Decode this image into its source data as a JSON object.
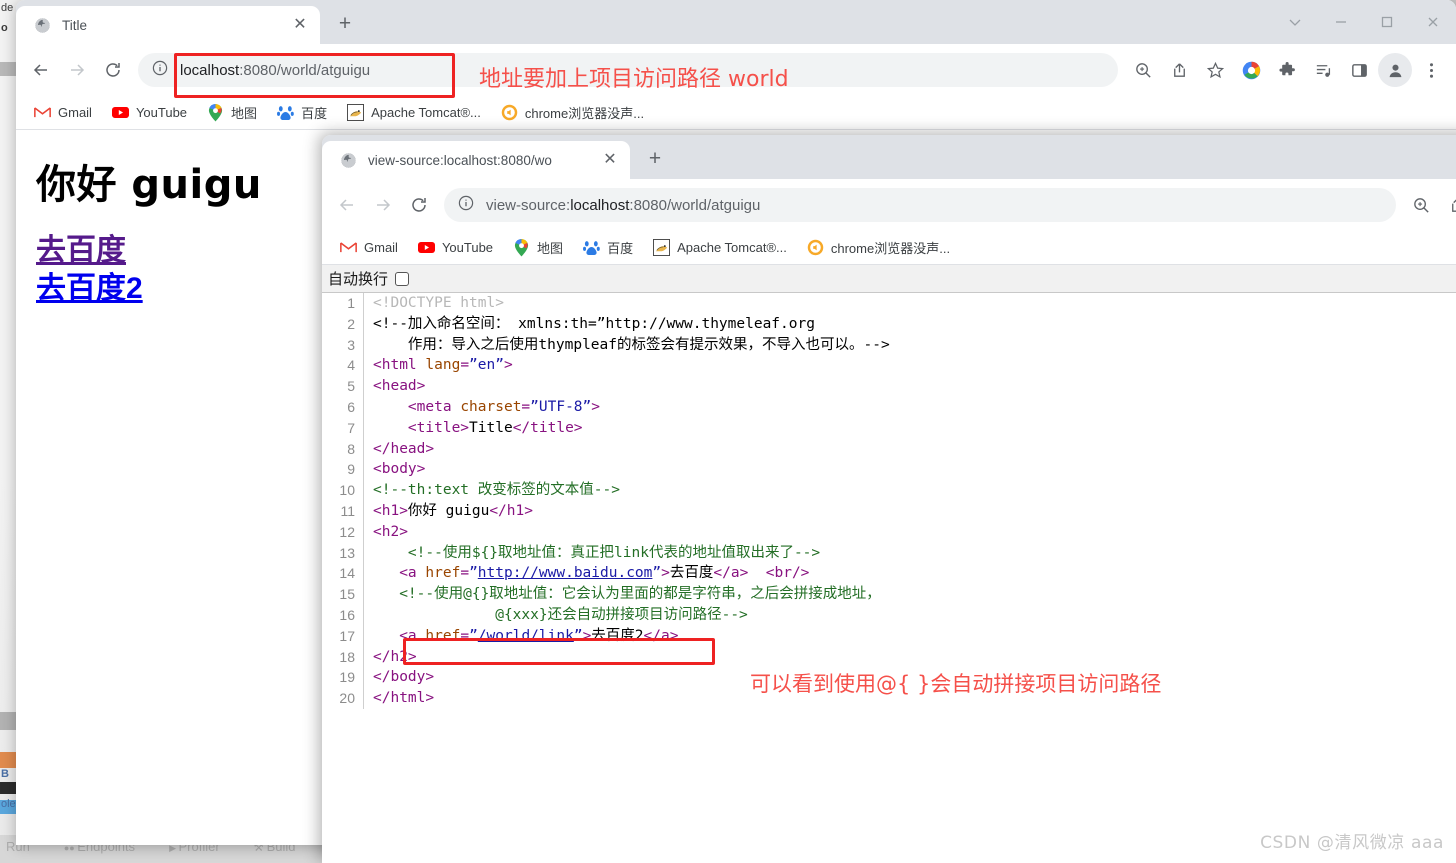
{
  "ide_backdrop": {
    "fragments": [
      "de",
      "o",
      "B",
      "ole",
      "Run"
    ],
    "bottom_items": [
      "Run",
      "Endpoints",
      "Profiler",
      "Build"
    ]
  },
  "window_back": {
    "tab": {
      "title": "Title",
      "favicon": "globe-icon",
      "close": "✕"
    },
    "newtab_label": "+",
    "window_controls": {
      "dropdown": "⌄",
      "minimize": "—",
      "maximize": "☐",
      "close": "✕"
    },
    "toolbar": {
      "back": "back-arrow-icon",
      "forward": "forward-arrow-icon",
      "reload": "reload-icon",
      "url": "localhost:8080/world/atguigu",
      "url_bold": "localhost",
      "url_rest": ":8080/world/atguigu",
      "right_icons": [
        "zoom-icon",
        "share-icon",
        "star-icon",
        "google-circle-icon",
        "extensions-icon",
        "media-list-icon",
        "side-panel-icon",
        "profile-icon",
        "menu-icon"
      ]
    },
    "bookmarks": [
      {
        "label": "Gmail",
        "icon": "gmail-icon"
      },
      {
        "label": "YouTube",
        "icon": "youtube-icon"
      },
      {
        "label": "地图",
        "icon": "maps-pin-icon"
      },
      {
        "label": "百度",
        "icon": "baidu-icon"
      },
      {
        "label": "Apache Tomcat®...",
        "icon": "tomcat-icon"
      },
      {
        "label": "chrome浏览器没声...",
        "icon": "chrome-sound-icon"
      }
    ],
    "page": {
      "heading": "你好 guigu",
      "link1": "去百度",
      "link2": "去百度2"
    }
  },
  "window_front": {
    "tab": {
      "title": "view-source:localhost:8080/wo",
      "favicon": "globe-icon",
      "close": "✕"
    },
    "newtab_label": "+",
    "toolbar": {
      "back": "back-arrow-icon",
      "forward": "forward-arrow-icon",
      "reload": "reload-icon",
      "url_prefix": "view-source:",
      "url_bold": "localhost",
      "url_rest": ":8080/world/atguigu",
      "right_icons": [
        "zoom-icon",
        "share-icon"
      ]
    },
    "bookmarks": [
      {
        "label": "Gmail",
        "icon": "gmail-icon"
      },
      {
        "label": "YouTube",
        "icon": "youtube-icon"
      },
      {
        "label": "地图",
        "icon": "maps-pin-icon"
      },
      {
        "label": "百度",
        "icon": "baidu-icon"
      },
      {
        "label": "Apache Tomcat®...",
        "icon": "tomcat-icon"
      },
      {
        "label": "chrome浏览器没声...",
        "icon": "chrome-sound-icon"
      }
    ],
    "wrapbar": {
      "label": "自动换行",
      "checked": false
    },
    "code_lines": [
      {
        "n": "1",
        "html": "<span class=\"c-doctype\">&lt;!DOCTYPE html&gt;</span>"
      },
      {
        "n": "2",
        "html": "<span class=\"c-comment-black\">&lt;!--加入命名空间： xmlns:th=”http://www.thymeleaf.org</span>"
      },
      {
        "n": "3",
        "html": "<span class=\"c-comment-black\">    作用：导入之后使用thympleaf的标签会有提示效果，不导入也可以。--&gt;</span>"
      },
      {
        "n": "4",
        "html": "<span class=\"c-tag\">&lt;html </span><span class=\"c-attr\">lang</span><span class=\"c-tag\">=</span><span class=\"c-quote\">”en”</span><span class=\"c-tag\">&gt;</span>"
      },
      {
        "n": "5",
        "html": "<span class=\"c-tag\">&lt;head&gt;</span>"
      },
      {
        "n": "6",
        "html": "    <span class=\"c-tag\">&lt;meta </span><span class=\"c-attr\">charset</span><span class=\"c-tag\">=</span><span class=\"c-quote\">”UTF-8”</span><span class=\"c-tag\">&gt;</span>"
      },
      {
        "n": "7",
        "html": "    <span class=\"c-tag\">&lt;title&gt;</span><span class=\"c-text\">Title</span><span class=\"c-tag\">&lt;/title&gt;</span>"
      },
      {
        "n": "8",
        "html": "<span class=\"c-tag\">&lt;/head&gt;</span>"
      },
      {
        "n": "9",
        "html": "<span class=\"c-tag\">&lt;body&gt;</span>"
      },
      {
        "n": "10",
        "html": "<span class=\"c-comment-green\">&lt;!--th:text 改变标签的文本值--&gt;</span>"
      },
      {
        "n": "11",
        "html": "<span class=\"c-tag\">&lt;h1&gt;</span><span class=\"c-text\">你好 guigu</span><span class=\"c-tag\">&lt;/h1&gt;</span>"
      },
      {
        "n": "12",
        "html": "<span class=\"c-tag\">&lt;h2&gt;</span>"
      },
      {
        "n": "13",
        "html": "    <span class=\"c-comment-green\">&lt;!--使用${}取地址值：真正把link代表的地址值取出来了--&gt;</span>"
      },
      {
        "n": "14",
        "html": "   <span class=\"c-tag\">&lt;a </span><span class=\"c-attr\">href</span><span class=\"c-tag\">=</span><span class=\"c-quote\">”</span><span class=\"c-val\">http://www.baidu.com</span><span class=\"c-quote\">”</span><span class=\"c-tag\">&gt;</span><span class=\"c-text\">去百度</span><span class=\"c-tag\">&lt;/a&gt;</span>  <span class=\"c-tag\">&lt;br/&gt;</span>"
      },
      {
        "n": "15",
        "html": "   <span class=\"c-comment-green\">&lt;!--使用@{}取地址值：它会认为里面的都是字符串，之后会拼接成地址，</span>"
      },
      {
        "n": "16",
        "html": "              <span class=\"c-comment-green\">@{xxx}还会自动拼接项目访问路径--&gt;</span>"
      },
      {
        "n": "17",
        "html": "   <span class=\"c-tag\">&lt;a </span><span class=\"c-attr\">href</span><span class=\"c-tag\">=</span><span class=\"c-quote\">”</span><span class=\"c-val\">/world/link</span><span class=\"c-quote\">”</span><span class=\"c-tag\">&gt;</span><span class=\"c-text\">去百度2</span><span class=\"c-tag\">&lt;/a&gt;</span>"
      },
      {
        "n": "18",
        "html": "<span class=\"c-tag\">&lt;/h2&gt;</span>"
      },
      {
        "n": "19",
        "html": "<span class=\"c-tag\">&lt;/body&gt;</span>"
      },
      {
        "n": "20",
        "html": "<span class=\"c-tag\">&lt;/html&gt;</span>"
      }
    ]
  },
  "annotations": {
    "url_note": "地址要加上项目访问路径 world",
    "code_note": "可以看到使用@{ }会自动拼接项目访问路径",
    "highlight_color": "#ee2222",
    "note_color": "#f5504a"
  },
  "watermark": "CSDN @清风微凉 aaa"
}
